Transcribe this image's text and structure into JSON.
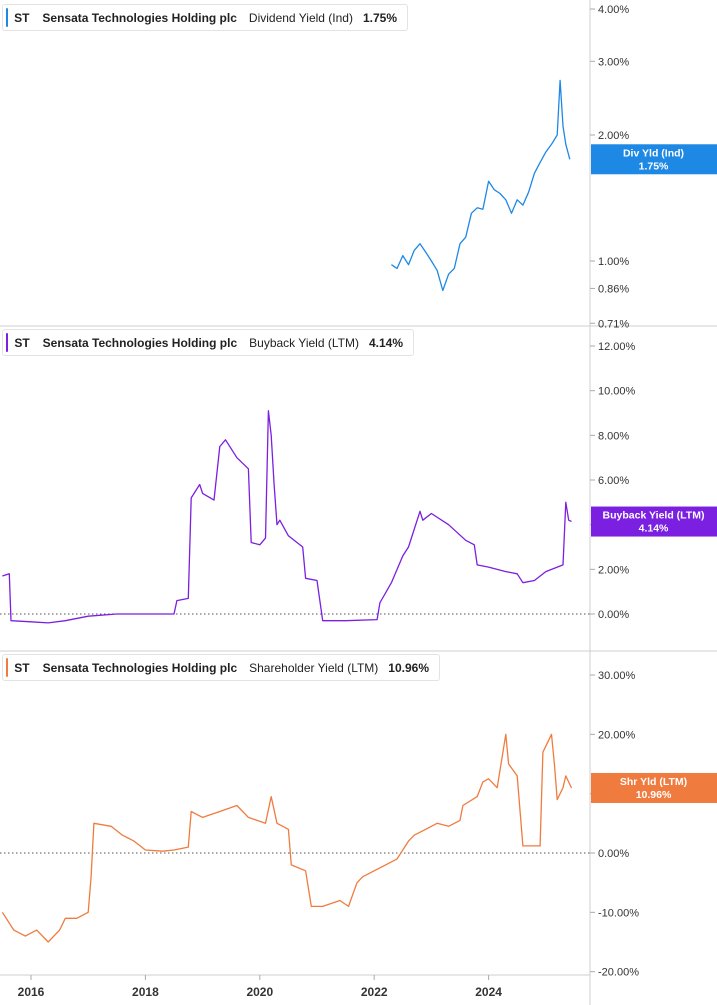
{
  "chart_data": [
    {
      "type": "line",
      "ticker": "ST",
      "company": "Sensata Technologies Holding plc",
      "metric": "Dividend Yield (Ind)",
      "value": "1.75%",
      "color": "#1e88e5",
      "scale": "log",
      "flag_label": "Div Yld (Ind)",
      "flag_value": "1.75%",
      "y_ticks": [
        "4.00%",
        "3.00%",
        "2.00%",
        "1.00%",
        "0.86%",
        "0.71%"
      ],
      "y_tick_values": [
        4.0,
        3.0,
        2.0,
        1.0,
        0.86,
        0.71
      ],
      "ylim": [
        0.71,
        4.2
      ],
      "zero_line": false,
      "x": [
        2022.3,
        2022.4,
        2022.5,
        2022.6,
        2022.7,
        2022.8,
        2022.9,
        2023.0,
        2023.1,
        2023.2,
        2023.3,
        2023.4,
        2023.5,
        2023.6,
        2023.7,
        2023.8,
        2023.9,
        2024.0,
        2024.1,
        2024.2,
        2024.3,
        2024.4,
        2024.5,
        2024.6,
        2024.7,
        2024.8,
        2024.9,
        2025.0,
        2025.1,
        2025.2,
        2025.25,
        2025.3,
        2025.35,
        2025.42
      ],
      "y": [
        0.98,
        0.96,
        1.03,
        0.98,
        1.06,
        1.1,
        1.05,
        1.0,
        0.95,
        0.85,
        0.93,
        0.96,
        1.1,
        1.14,
        1.3,
        1.34,
        1.33,
        1.55,
        1.48,
        1.45,
        1.4,
        1.3,
        1.4,
        1.36,
        1.46,
        1.62,
        1.72,
        1.82,
        1.9,
        2.0,
        2.7,
        2.1,
        1.9,
        1.75
      ]
    },
    {
      "type": "line",
      "ticker": "ST",
      "company": "Sensata Technologies Holding plc",
      "metric": "Buyback Yield (LTM)",
      "value": "4.14%",
      "color": "#7b1fe0",
      "scale": "linear",
      "flag_label": "Buyback Yield (LTM)",
      "flag_value": "4.14%",
      "y_ticks": [
        "12.00%",
        "10.00%",
        "8.00%",
        "6.00%",
        "4.00%",
        "2.00%",
        "0.00%"
      ],
      "y_tick_values": [
        12,
        10,
        8,
        6,
        4,
        2,
        0
      ],
      "ylim": [
        -0.5,
        12.5
      ],
      "zero_line": true,
      "x": [
        2015.5,
        2015.62,
        2015.65,
        2016.0,
        2016.3,
        2016.6,
        2017.0,
        2017.5,
        2018.0,
        2018.5,
        2018.55,
        2018.75,
        2018.8,
        2018.95,
        2019.0,
        2019.2,
        2019.3,
        2019.4,
        2019.6,
        2019.8,
        2019.85,
        2020.0,
        2020.1,
        2020.15,
        2020.2,
        2020.25,
        2020.3,
        2020.35,
        2020.5,
        2020.75,
        2020.8,
        2021.0,
        2021.1,
        2021.5,
        2022.05,
        2022.1,
        2022.3,
        2022.5,
        2022.6,
        2022.8,
        2022.85,
        2023.0,
        2023.3,
        2023.6,
        2023.75,
        2023.8,
        2024.0,
        2024.3,
        2024.5,
        2024.6,
        2024.8,
        2025.0,
        2025.3,
        2025.35,
        2025.4,
        2025.45
      ],
      "y": [
        1.7,
        1.8,
        -0.3,
        -0.35,
        -0.4,
        -0.3,
        -0.1,
        0.0,
        0.0,
        0.0,
        0.6,
        0.7,
        5.2,
        5.8,
        5.4,
        5.1,
        7.5,
        7.8,
        7.0,
        6.5,
        3.2,
        3.1,
        3.4,
        9.1,
        8.0,
        5.8,
        4.0,
        4.2,
        3.5,
        3.0,
        1.6,
        1.5,
        -0.3,
        -0.3,
        -0.25,
        0.5,
        1.4,
        2.6,
        3.0,
        4.6,
        4.2,
        4.5,
        4.0,
        3.3,
        3.1,
        2.2,
        2.1,
        1.9,
        1.8,
        1.4,
        1.5,
        1.9,
        2.2,
        5.0,
        4.2,
        4.14
      ]
    },
    {
      "type": "line",
      "ticker": "ST",
      "company": "Sensata Technologies Holding plc",
      "metric": "Shareholder Yield (LTM)",
      "value": "10.96%",
      "color": "#f07b3f",
      "scale": "linear",
      "flag_label": "Shr Yld (LTM)",
      "flag_value": "10.96%",
      "y_ticks": [
        "30.00%",
        "20.00%",
        "10.00%",
        "0.00%",
        "-10.00%",
        "-20.00%"
      ],
      "y_tick_values": [
        30,
        20,
        10,
        0,
        -10,
        -20
      ],
      "ylim": [
        -20,
        33
      ],
      "zero_line": true,
      "x": [
        2015.5,
        2015.7,
        2015.9,
        2016.1,
        2016.3,
        2016.5,
        2016.6,
        2016.8,
        2017.0,
        2017.05,
        2017.1,
        2017.4,
        2017.6,
        2017.8,
        2018.0,
        2018.3,
        2018.5,
        2018.75,
        2018.8,
        2019.0,
        2019.3,
        2019.6,
        2019.8,
        2020.1,
        2020.2,
        2020.3,
        2020.5,
        2020.55,
        2020.8,
        2020.9,
        2021.1,
        2021.4,
        2021.55,
        2021.7,
        2021.8,
        2022.0,
        2022.2,
        2022.4,
        2022.6,
        2022.7,
        2022.9,
        2023.1,
        2023.3,
        2023.5,
        2023.55,
        2023.8,
        2023.9,
        2024.0,
        2024.05,
        2024.15,
        2024.3,
        2024.35,
        2024.5,
        2024.6,
        2024.65,
        2024.9,
        2024.95,
        2025.0,
        2025.1,
        2025.15,
        2025.2,
        2025.3,
        2025.35,
        2025.45
      ],
      "y": [
        -10,
        -13,
        -14,
        -13,
        -15,
        -13,
        -11,
        -11,
        -10,
        -4,
        5,
        4.5,
        3,
        2,
        0.5,
        0.3,
        0.5,
        1,
        7,
        6,
        7,
        8,
        6,
        5,
        9.5,
        5,
        4,
        -2,
        -3,
        -9,
        -9,
        -8,
        -9,
        -5,
        -4,
        -3,
        -2,
        -1,
        2,
        3,
        4,
        5,
        4.5,
        5.5,
        8,
        9.5,
        12,
        12.5,
        12,
        11,
        20,
        15,
        13,
        1.2,
        1.2,
        1.2,
        17,
        18,
        20,
        15,
        9,
        11,
        13,
        10.96
      ]
    }
  ],
  "x_axis": {
    "tick_labels": [
      "2016",
      "2018",
      "2020",
      "2022",
      "2024"
    ],
    "tick_values": [
      2016,
      2018,
      2020,
      2022,
      2024
    ],
    "range": [
      2015.45,
      2025.7
    ]
  }
}
